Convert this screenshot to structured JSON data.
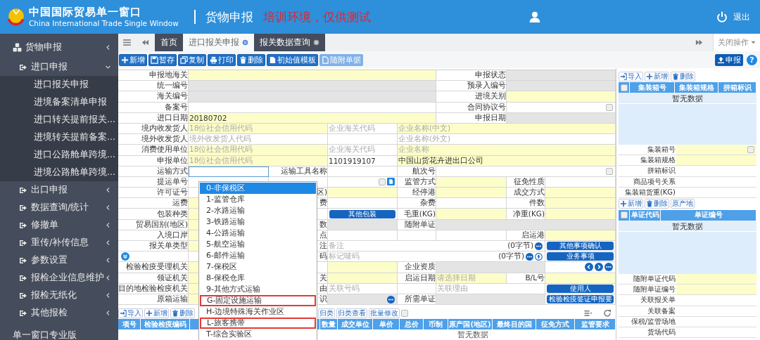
{
  "header": {
    "title": "中国国际贸易单一窗口",
    "subtitle": "China International Trade Single Window",
    "module": "货物申报",
    "notice": "培训环境，仅供测试",
    "logout": "退出"
  },
  "sidebar": {
    "items": [
      {
        "label": "货物申报",
        "expanded": false,
        "children": [
          {
            "label": "进口申报",
            "expanded": true,
            "children": [
              {
                "label": "进口报关申报"
              },
              {
                "label": "进境备案清单申报"
              },
              {
                "label": "进口转关提前报关..."
              },
              {
                "label": "进境转关提前备案..."
              },
              {
                "label": "进口公路舱单跨境..."
              },
              {
                "label": "进境公路舱单跨境..."
              }
            ]
          },
          {
            "label": "出口申报",
            "expanded": false
          },
          {
            "label": "数据查询/统计",
            "expanded": false
          },
          {
            "label": "修撤单",
            "expanded": false
          },
          {
            "label": "重传/补传信息",
            "expanded": false
          },
          {
            "label": "参数设置",
            "expanded": false
          },
          {
            "label": "报检企业信息维护",
            "expanded": false
          },
          {
            "label": "报检无纸化",
            "expanded": false
          },
          {
            "label": "其他报检",
            "expanded": false
          }
        ]
      },
      {
        "label": "单一窗口专业版"
      }
    ]
  },
  "tabs": [
    {
      "label": "首页",
      "selected": false,
      "closable": false
    },
    {
      "label": "进口报关申报",
      "selected": true,
      "closable": true
    },
    {
      "label": "报关数据查询",
      "selected": false,
      "closable": true
    }
  ],
  "tab_actions": "关闭操作",
  "toolbar": {
    "buttons": [
      {
        "label": "新增",
        "disabled": false
      },
      {
        "label": "暂存",
        "disabled": false
      },
      {
        "label": "复制",
        "disabled": false
      },
      {
        "label": "打印",
        "disabled": false
      },
      {
        "label": "删除",
        "disabled": false
      },
      {
        "label": "初始值模板",
        "disabled": false
      },
      {
        "label": "随附单据",
        "disabled": true
      }
    ],
    "submit": "申报",
    "help": "?"
  },
  "form": {
    "rows": [
      {
        "cells": [
          {
            "kind": "label",
            "text": "申报地海关"
          },
          {
            "kind": "field",
            "required": true,
            "readonly": false
          },
          {
            "kind": "label",
            "text": "申报状态"
          },
          {
            "kind": "field",
            "required": false,
            "readonly": true
          }
        ]
      },
      {
        "cells": [
          {
            "kind": "label",
            "text": "统一编号"
          },
          {
            "kind": "field",
            "required": false,
            "readonly": true
          },
          {
            "kind": "label",
            "text": "预录入编号"
          },
          {
            "kind": "field",
            "required": false,
            "readonly": true
          }
        ]
      },
      {
        "cells": [
          {
            "kind": "label",
            "text": "海关编号"
          },
          {
            "kind": "field",
            "required": false,
            "readonly": true
          },
          {
            "kind": "label",
            "text": "进境关别"
          },
          {
            "kind": "field",
            "required": true,
            "readonly": false
          }
        ]
      },
      {
        "cells": [
          {
            "kind": "label",
            "text": "备案号"
          },
          {
            "kind": "field",
            "required": false,
            "readonly": false
          },
          {
            "kind": "label",
            "text": "合同协议号"
          },
          {
            "kind": "field",
            "required": false,
            "readonly": false,
            "checked": false
          }
        ]
      },
      {
        "cells": [
          {
            "kind": "label",
            "text": "进口日期"
          },
          {
            "kind": "field",
            "required": true,
            "readonly": false,
            "value": "20180702"
          },
          {
            "kind": "label",
            "text": "申报日期"
          },
          {
            "kind": "field",
            "required": false,
            "readonly": true
          }
        ]
      },
      {
        "cells": [
          {
            "kind": "label",
            "text": "境内收发货人"
          },
          {
            "kind": "field",
            "required": true,
            "readonly": false,
            "placeholder": "18位社会信用代码"
          },
          {
            "kind": "field",
            "required": false,
            "readonly": false,
            "placeholder": "企业海关代码"
          },
          {
            "kind": "field",
            "required": true,
            "readonly": false,
            "placeholder": "企业名称(中文)"
          }
        ]
      },
      {
        "cells": [
          {
            "kind": "label",
            "text": "境外收发货人"
          },
          {
            "kind": "field",
            "required": false,
            "readonly": false,
            "placeholder": "境外收发货人代码"
          },
          {
            "kind": "blank"
          },
          {
            "kind": "field",
            "required": false,
            "readonly": false,
            "placeholder": "企业名称(外文)"
          }
        ]
      },
      {
        "cells": [
          {
            "kind": "label",
            "text": "消费使用单位"
          },
          {
            "kind": "field",
            "required": true,
            "readonly": false,
            "placeholder": "18位社会信用代码"
          },
          {
            "kind": "field",
            "required": false,
            "readonly": false,
            "placeholder": "企业海关代码"
          },
          {
            "kind": "field",
            "required": true,
            "readonly": false,
            "placeholder": "企业名称"
          }
        ]
      },
      {
        "cells": [
          {
            "kind": "label",
            "text": "申报单位"
          },
          {
            "kind": "field",
            "required": true,
            "readonly": false,
            "placeholder": "18位社会信用代码"
          },
          {
            "kind": "field",
            "required": false,
            "readonly": false,
            "value": "1101919107"
          },
          {
            "kind": "field",
            "required": true,
            "readonly": false,
            "value": "中国山货花卉进出口公司"
          }
        ]
      },
      {
        "cells": [
          {
            "kind": "label",
            "text": "运输方式"
          },
          {
            "kind": "field",
            "required": false,
            "readonly": false,
            "focused": true
          },
          {
            "kind": "label",
            "text": "运输工具名称"
          },
          {
            "kind": "field",
            "required": false,
            "readonly": false
          },
          {
            "kind": "label",
            "text": "航次号"
          },
          {
            "kind": "field",
            "required": false,
            "readonly": false,
            "checked": false
          }
        ]
      },
      {
        "cells": [
          {
            "kind": "label",
            "text": "提运单号"
          },
          {
            "kind": "field",
            "required": false,
            "readonly": false
          },
          {
            "kind": "blank"
          },
          {
            "kind": "picker",
            "required": false,
            "readonly": false,
            "checked": false
          },
          {
            "kind": "label",
            "text": "监管方式"
          },
          {
            "kind": "field",
            "required": true,
            "readonly": false
          },
          {
            "kind": "label",
            "text": "征免性质"
          },
          {
            "kind": "field",
            "required": false,
            "readonly": false
          }
        ]
      },
      {
        "cells": [
          {
            "kind": "label",
            "text": "许可证号"
          },
          {
            "kind": "field",
            "required": false,
            "readonly": false
          },
          {
            "kind": "label",
            "text": "区)"
          },
          {
            "kind": "field",
            "required": true,
            "readonly": false
          },
          {
            "kind": "label",
            "text": "经停港"
          },
          {
            "kind": "field",
            "required": true,
            "readonly": false
          },
          {
            "kind": "label",
            "text": "成交方式"
          },
          {
            "kind": "field",
            "required": true,
            "readonly": false
          }
        ]
      },
      {
        "cells": [
          {
            "kind": "label",
            "text": "运费"
          },
          {
            "kind": "field",
            "required": true,
            "readonly": false
          },
          {
            "kind": "label",
            "text": "费"
          },
          {
            "kind": "field",
            "required": false,
            "readonly": false
          },
          {
            "kind": "label",
            "text": "杂费"
          },
          {
            "kind": "field",
            "required": false,
            "readonly": false
          },
          {
            "kind": "label",
            "text": "件数"
          },
          {
            "kind": "field",
            "required": true,
            "readonly": false
          }
        ]
      },
      {
        "cells": [
          {
            "kind": "label",
            "text": "包装种类"
          },
          {
            "kind": "field",
            "required": true,
            "readonly": false
          },
          {
            "kind": "blank"
          },
          {
            "kind": "button",
            "label": "其他包装"
          },
          {
            "kind": "label",
            "text": "毛重(KG)"
          },
          {
            "kind": "field",
            "required": true,
            "readonly": false
          },
          {
            "kind": "label",
            "text": "净重(KG)"
          },
          {
            "kind": "field",
            "required": true,
            "readonly": false
          }
        ]
      },
      {
        "cells": [
          {
            "kind": "label",
            "text": "贸易国别(地区)"
          },
          {
            "kind": "field",
            "required": true,
            "readonly": false
          },
          {
            "kind": "label",
            "text": "数"
          },
          {
            "kind": "field",
            "required": false,
            "readonly": true
          },
          {
            "kind": "label",
            "text": "随附单证"
          },
          {
            "kind": "field",
            "required": false,
            "readonly": true
          }
        ]
      },
      {
        "cells": [
          {
            "kind": "label",
            "text": "入境口岸"
          },
          {
            "kind": "field",
            "required": true,
            "readonly": false
          },
          {
            "kind": "label",
            "text": "点"
          },
          {
            "kind": "field",
            "required": false,
            "readonly": false
          },
          {
            "kind": "blank"
          },
          {
            "kind": "field",
            "required": false,
            "readonly": false
          },
          {
            "kind": "label",
            "text": "启运港"
          },
          {
            "kind": "field",
            "required": true,
            "readonly": false
          }
        ]
      },
      {
        "cells": [
          {
            "kind": "label",
            "text": "报关单类型"
          },
          {
            "kind": "field",
            "required": true,
            "readonly": false
          },
          {
            "kind": "label",
            "text": "注"
          },
          {
            "kind": "note",
            "required": false,
            "readonly": false,
            "placeholder": "备注",
            "counter": "(0字节)"
          },
          {
            "kind": "button",
            "label": "其他事项确认"
          }
        ]
      },
      {
        "cells": [
          {
            "kind": "expander"
          },
          {
            "kind": "field",
            "required": false,
            "readonly": false
          },
          {
            "kind": "label",
            "text": "码"
          },
          {
            "kind": "note_upload",
            "required": false,
            "readonly": false,
            "placeholder": "标记唛码",
            "counter": "(0字节)"
          },
          {
            "kind": "button",
            "label": "业务事项"
          }
        ]
      },
      {
        "cells": [
          {
            "kind": "label",
            "text": "检验检疫受理机关"
          },
          {
            "kind": "field",
            "required": true,
            "readonly": false
          },
          {
            "kind": "blank"
          },
          {
            "kind": "field",
            "required": true,
            "readonly": false
          },
          {
            "kind": "label",
            "text": "企业资质"
          },
          {
            "kind": "field",
            "required": false,
            "readonly": true
          },
          {
            "kind": "pager"
          }
        ]
      },
      {
        "cells": [
          {
            "kind": "label",
            "text": "领证机关"
          },
          {
            "kind": "field",
            "required": true,
            "readonly": false
          },
          {
            "kind": "label",
            "text": "关"
          },
          {
            "kind": "field",
            "required": true,
            "readonly": false
          },
          {
            "kind": "label",
            "text": "启运日期"
          },
          {
            "kind": "field",
            "required": true,
            "readonly": false,
            "placeholder": "请选择日期"
          },
          {
            "kind": "label",
            "text": "B/L号"
          },
          {
            "kind": "field",
            "required": true,
            "readonly": false
          }
        ]
      },
      {
        "cells": [
          {
            "kind": "label",
            "text": "目的地检验检疫机关"
          },
          {
            "kind": "field",
            "required": true,
            "readonly": false
          },
          {
            "kind": "label",
            "text": "由"
          },
          {
            "kind": "field",
            "required": false,
            "readonly": false,
            "placeholder": "关联号码"
          },
          {
            "kind": "blank"
          },
          {
            "kind": "field",
            "required": false,
            "readonly": false,
            "placeholder": "关联理由"
          },
          {
            "kind": "button",
            "label": "使用人"
          }
        ]
      },
      {
        "cells": [
          {
            "kind": "label",
            "text": "原箱运输"
          },
          {
            "kind": "field",
            "required": true,
            "readonly": false
          },
          {
            "kind": "label",
            "text": "识"
          },
          {
            "kind": "lookup",
            "required": false,
            "readonly": true
          },
          {
            "kind": "label",
            "text": "所需单证"
          },
          {
            "kind": "field",
            "required": false,
            "readonly": true
          },
          {
            "kind": "button",
            "label": "检验检疫签证申报要"
          }
        ]
      }
    ]
  },
  "goods": {
    "toolbar": [
      "导入",
      "新增",
      "删除",
      "归类",
      "归类查看",
      "批量修改"
    ],
    "batch_checked": false,
    "columns": [
      "项号",
      "检验检疫编码",
      "数量",
      "成交单位",
      "单价",
      "总价",
      "币制",
      "原产国(地区)",
      "最终目的国",
      "征免方式",
      "监管要求"
    ],
    "empty": "暂无数据"
  },
  "transport_dropdown": {
    "options": [
      {
        "label": "0-非保税区",
        "selected": true,
        "highlighted": false
      },
      {
        "label": "1-监管仓库",
        "selected": false,
        "highlighted": false
      },
      {
        "label": "2-水路运输",
        "selected": false,
        "highlighted": false
      },
      {
        "label": "3-铁路运输",
        "selected": false,
        "highlighted": false
      },
      {
        "label": "4-公路运输",
        "selected": false,
        "highlighted": false
      },
      {
        "label": "5-航空运输",
        "selected": false,
        "highlighted": false
      },
      {
        "label": "6-邮件运输",
        "selected": false,
        "highlighted": false
      },
      {
        "label": "7-保税区",
        "selected": false,
        "highlighted": false
      },
      {
        "label": "8-保税仓库",
        "selected": false,
        "highlighted": false
      },
      {
        "label": "9-其他方式运输",
        "selected": false,
        "highlighted": false
      },
      {
        "label": "G-固定设施运输",
        "selected": false,
        "highlighted": true
      },
      {
        "label": "H-边境特殊海关作业区",
        "selected": false,
        "highlighted": false
      },
      {
        "label": "L-旅客携带",
        "selected": false,
        "highlighted": true
      },
      {
        "label": "T-综合实验区",
        "selected": false,
        "highlighted": false
      }
    ]
  },
  "containers": {
    "toolbar": [
      "导入",
      "新增",
      "删除"
    ],
    "select_all_checked": false,
    "columns": [
      "集装箱号",
      "集装箱规格",
      "拼箱标识"
    ],
    "empty": "暂无数据",
    "fields": [
      {
        "label": "集装箱号",
        "required": true,
        "checked": false
      },
      {
        "label": "集装箱规格",
        "required": true
      },
      {
        "label": "拼箱标识",
        "required": false
      },
      {
        "label": "商品项号关系",
        "required": false
      },
      {
        "label": "集装箱货重(KG)",
        "required": false
      }
    ]
  },
  "documents": {
    "toolbar": [
      "新增",
      "删除",
      "原产地"
    ],
    "select_all_checked": false,
    "columns": [
      "单证代码",
      "单证编号"
    ],
    "empty": "暂无数据",
    "fields": [
      {
        "label": "随附单证代码",
        "required": true
      },
      {
        "label": "随附单证编号",
        "required": true
      },
      {
        "label": "关联报关单",
        "required": false
      },
      {
        "label": "关联备案",
        "required": false
      },
      {
        "label": "保税/监管场地",
        "required": false
      },
      {
        "label": "货场代码",
        "required": false
      }
    ]
  }
}
